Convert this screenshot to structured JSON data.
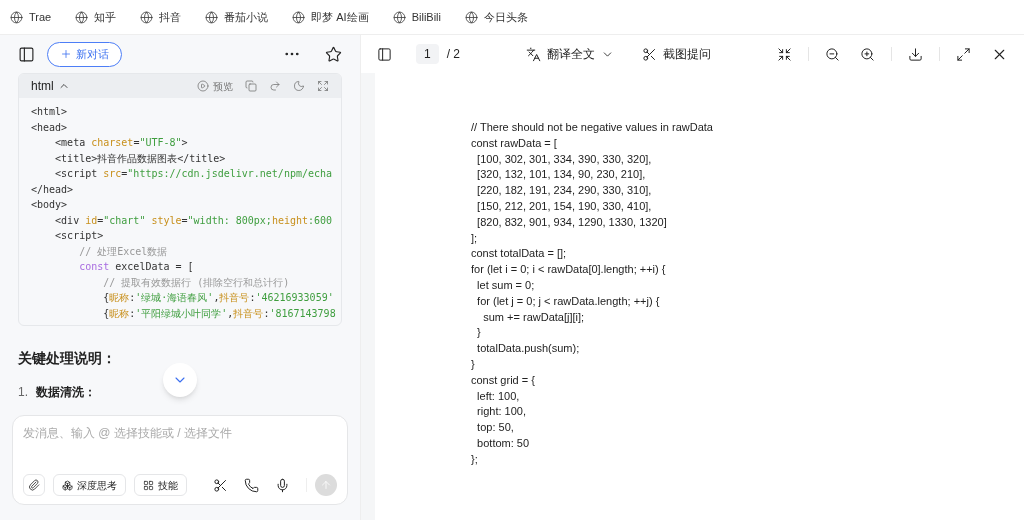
{
  "bookmarks": [
    {
      "label": "Trae"
    },
    {
      "label": "知乎"
    },
    {
      "label": "抖音"
    },
    {
      "label": "番茄小说"
    },
    {
      "label": "即梦 AI绘画"
    },
    {
      "label": "BiliBili"
    },
    {
      "label": "今日头条"
    }
  ],
  "chat": {
    "new_chat": "新对话",
    "code_block": {
      "language": "html",
      "preview": "预览",
      "lines": [
        [
          {
            "kind": "tag",
            "text": "<html>"
          }
        ],
        [
          {
            "kind": "tag",
            "text": "<head>"
          }
        ],
        [
          {
            "kind": "tag",
            "text": "    <meta "
          },
          {
            "kind": "attr",
            "text": "charset"
          },
          {
            "kind": "tag",
            "text": "="
          },
          {
            "kind": "string",
            "text": "\"UTF-8\""
          },
          {
            "kind": "tag",
            "text": ">"
          }
        ],
        [
          {
            "kind": "tag",
            "text": "    <title>抖音作品数据图表</title>"
          }
        ],
        [
          {
            "kind": "tag",
            "text": "    <script "
          },
          {
            "kind": "attr",
            "text": "src"
          },
          {
            "kind": "tag",
            "text": "="
          },
          {
            "kind": "string",
            "text": "\"https://cdn.jsdelivr.net/npm/echa"
          }
        ],
        [
          {
            "kind": "tag",
            "text": "</head>"
          }
        ],
        [
          {
            "kind": "tag",
            "text": "<body>"
          }
        ],
        [
          {
            "kind": "tag",
            "text": "    <div "
          },
          {
            "kind": "attr",
            "text": "id"
          },
          {
            "kind": "tag",
            "text": "="
          },
          {
            "kind": "string",
            "text": "\"chart\""
          },
          {
            "kind": "attr",
            "text": " style"
          },
          {
            "kind": "tag",
            "text": "="
          },
          {
            "kind": "string",
            "text": "\"width: 800px;"
          },
          {
            "kind": "attr",
            "text": "height"
          },
          {
            "kind": "string",
            "text": ":600"
          }
        ],
        [
          {
            "kind": "tag",
            "text": "    <script>"
          }
        ],
        [
          {
            "kind": "comment",
            "text": "        // 处理Excel数据"
          }
        ],
        [
          {
            "kind": "keyword",
            "text": "        const"
          },
          {
            "kind": "plain",
            "text": " excelData = ["
          }
        ],
        [
          {
            "kind": "comment",
            "text": "            // 提取有效数据行 (排除空行和总计行)"
          }
        ],
        [
          {
            "kind": "plain",
            "text": "            {"
          },
          {
            "kind": "attr",
            "text": "昵称"
          },
          {
            "kind": "plain",
            "text": ":"
          },
          {
            "kind": "string",
            "text": "'绿城·海语春风'"
          },
          {
            "kind": "plain",
            "text": ","
          },
          {
            "kind": "attr",
            "text": "抖音号"
          },
          {
            "kind": "plain",
            "text": ":"
          },
          {
            "kind": "string",
            "text": "'46216933059'"
          }
        ],
        [
          {
            "kind": "plain",
            "text": "            {"
          },
          {
            "kind": "attr",
            "text": "昵称"
          },
          {
            "kind": "plain",
            "text": ":"
          },
          {
            "kind": "string",
            "text": "'平阳绿城小叶同学'"
          },
          {
            "kind": "plain",
            "text": ","
          },
          {
            "kind": "attr",
            "text": "抖音号"
          },
          {
            "kind": "plain",
            "text": ":"
          },
          {
            "kind": "string",
            "text": "'8167143798"
          }
        ]
      ]
    },
    "heading": "关键处理说明：",
    "list_item": {
      "number": "1.",
      "text": "数据清洗："
    },
    "input": {
      "placeholder": "发消息、输入 @ 选择技能或 / 选择文件"
    },
    "chips": [
      "深度思考",
      "技能"
    ]
  },
  "viewer": {
    "page": "1",
    "total": "/ 2",
    "translate": "翻译全文",
    "screenshot_ask": "截图提问",
    "doc_lines": [
      "// There should not be negative values in rawData",
      "const rawData = [",
      "  [100, 302, 301, 334, 390, 330, 320],",
      "  [320, 132, 101, 134, 90, 230, 210],",
      "  [220, 182, 191, 234, 290, 330, 310],",
      "  [150, 212, 201, 154, 190, 330, 410],",
      "  [820, 832, 901, 934, 1290, 1330, 1320]",
      "];",
      "const totalData = [];",
      "for (let i = 0; i < rawData[0].length; ++i) {",
      "  let sum = 0;",
      "  for (let j = 0; j < rawData.length; ++j) {",
      "    sum += rawData[j][i];",
      "  }",
      "  totalData.push(sum);",
      "}",
      "const grid = {",
      "  left: 100,",
      "  right: 100,",
      "  top: 50,",
      "  bottom: 50",
      "};"
    ]
  }
}
